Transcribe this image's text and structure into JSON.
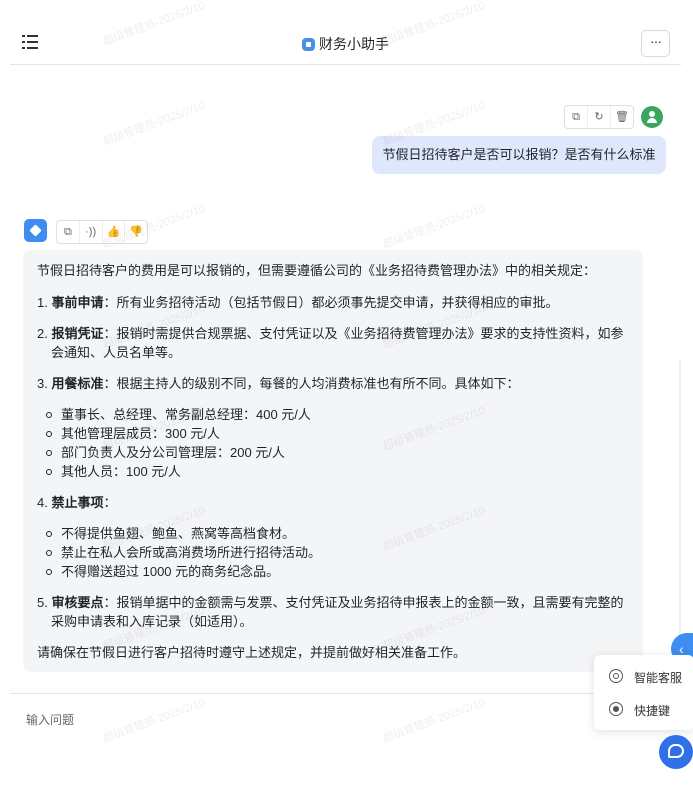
{
  "header": {
    "title": "财务小助手",
    "more_label": "···"
  },
  "user_message": {
    "text": "节假日招待客户是否可以报销？是否有什么标准",
    "tools": [
      "copy-icon",
      "refresh-icon",
      "delete-icon"
    ]
  },
  "bot_message": {
    "tools": [
      "copy-icon",
      "speaker-icon",
      "thumbs-up-icon",
      "thumbs-down-icon"
    ],
    "intro": "节假日招待客户的费用是可以报销的，但需要遵循公司的《业务招待费管理办法》中的相关规定：",
    "sections": [
      {
        "num": "1.",
        "title": "事前申请",
        "text": "：所有业务招待活动（包括节假日）都必须事先提交申请，并获得相应的审批。"
      },
      {
        "num": "2.",
        "title": "报销凭证",
        "text": "：报销时需提供合规票据、支付凭证以及《业务招待费管理办法》要求的支持性资料，如参会通知、人员名单等。"
      },
      {
        "num": "3.",
        "title": "用餐标准",
        "text": "：根据主持人的级别不同，每餐的人均消费标准也有所不同。具体如下：",
        "items": [
          "董事长、总经理、常务副总经理：400 元/人",
          "其他管理层成员：300 元/人",
          "部门负责人及分公司管理层：200 元/人",
          "其他人员：100 元/人"
        ]
      },
      {
        "num": "4.",
        "title": "禁止事项",
        "text": "：",
        "items": [
          "不得提供鱼翅、鲍鱼、燕窝等高档食材。",
          "禁止在私人会所或高消费场所进行招待活动。",
          "不得赠送超过 1000 元的商务纪念品。"
        ]
      },
      {
        "num": "5.",
        "title": "审核要点",
        "text": "：报销单据中的金额需与发票、支付凭证及业务招待申报表上的金额一致，且需要有完整的采购申请表和入库记录（如适用）。"
      }
    ],
    "closing": "请确保在节假日进行客户招待时遵守上述规定，并提前做好相关准备工作。"
  },
  "input": {
    "placeholder": "输入问题"
  },
  "float_menu": {
    "items": [
      {
        "icon": "gear-icon",
        "label": "智能客服"
      },
      {
        "icon": "target-icon",
        "label": "快捷键"
      }
    ]
  },
  "watermark": "超级管理员-2025/2/10",
  "colors": {
    "accent": "#3d8ef0",
    "user_bubble": "#dfe7fc",
    "bot_bubble": "#f4f5f7",
    "avatar_green": "#3aa55d"
  }
}
